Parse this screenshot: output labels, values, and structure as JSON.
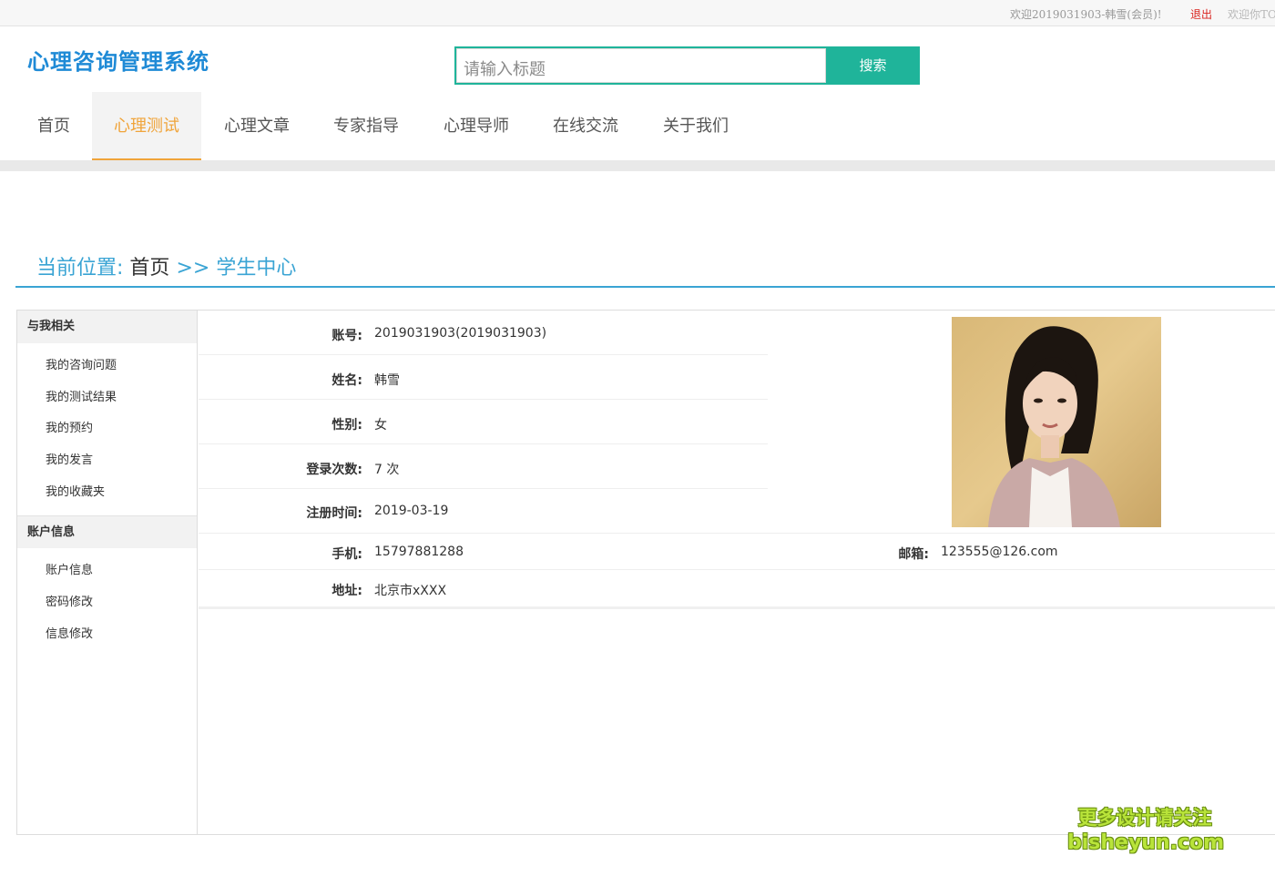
{
  "topbar": {
    "welcome": "欢迎2019031903-韩雪(会员)!",
    "logout": "退出",
    "welcome_right": "欢迎你TO"
  },
  "site": {
    "title": "心理咨询管理系统"
  },
  "search": {
    "placeholder": "请输入标题",
    "button": "搜索"
  },
  "nav": {
    "items": [
      {
        "label": "首页"
      },
      {
        "label": "心理测试"
      },
      {
        "label": "心理文章"
      },
      {
        "label": "专家指导"
      },
      {
        "label": "心理导师"
      },
      {
        "label": "在线交流"
      },
      {
        "label": "关于我们"
      }
    ]
  },
  "breadcrumb": {
    "prefix": "当前位置:",
    "home": "首页",
    "separator": ">>",
    "current": "学生中心"
  },
  "sidebar": {
    "section1": {
      "title": "与我相关",
      "items": [
        "我的咨询问题",
        "我的测试结果",
        "我的预约",
        "我的发言",
        "我的收藏夹"
      ]
    },
    "section2": {
      "title": "账户信息",
      "items": [
        "账户信息",
        "密码修改",
        "信息修改"
      ]
    }
  },
  "profile": {
    "account_label": "账号:",
    "account": "2019031903(2019031903)",
    "name_label": "姓名:",
    "name": "韩雪",
    "gender_label": "性别:",
    "gender": "女",
    "logins_label": "登录次数:",
    "logins": "7 次",
    "registered_label": "注册时间:",
    "registered": "2019-03-19",
    "phone_label": "手机:",
    "phone": "15797881288",
    "email_label": "邮箱:",
    "email": "123555@126.com",
    "address_label": "地址:",
    "address": "北京市xXXX"
  },
  "watermark": {
    "line1": "更多设计请关注",
    "line2": "bisheyun.com"
  },
  "colors": {
    "brand": "#1f8ad6",
    "search_green": "#1fb49a",
    "nav_active": "#f0a43a",
    "crumb_blue": "#3aa4d4",
    "logout_red": "#d9231e"
  }
}
